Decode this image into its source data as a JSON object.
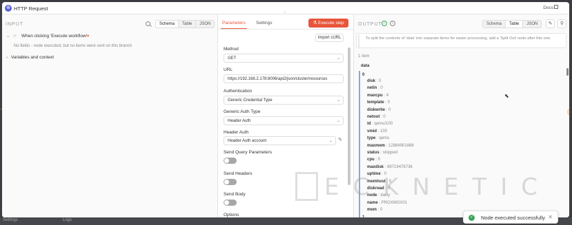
{
  "window": {
    "title": "HTTP Request",
    "docs_label": "Docs"
  },
  "input": {
    "label": "INPUT",
    "views": [
      "Schema",
      "Table",
      "JSON"
    ],
    "active_view": "Schema",
    "trigger_label": "When clicking 'Execute workflow'",
    "no_fields_text": "No fields - node executed, but no items were sent on this branch",
    "vars_label": "Variables and context"
  },
  "params": {
    "tabs": [
      "Parameters",
      "Settings"
    ],
    "execute_label": "Execute step",
    "import_curl_label": "Import cURL",
    "method_label": "Method",
    "method_value": "GET",
    "url_label": "URL",
    "url_value": "https://192.168.2.178:8006/api2/json/cluster/resources",
    "auth_label": "Authentication",
    "auth_value": "Generic Credential Type",
    "generic_auth_label": "Generic Auth Type",
    "generic_auth_value": "Header Auth",
    "header_auth_label": "Header Auth",
    "header_auth_value": "Header Auth account",
    "send_query_label": "Send Query Parameters",
    "send_headers_label": "Send Headers",
    "send_body_label": "Send Body",
    "options_label": "Options"
  },
  "output": {
    "label": "OUTPUT",
    "views": [
      "Schema",
      "Table",
      "JSON"
    ],
    "active_view": "Table",
    "notice": "To split the contents of 'data' into separate items for easier processing, add a 'Split Out' node after this one.",
    "item_count": "1 item",
    "root_key": "data",
    "index_0": "0",
    "index_1": "1",
    "fields": [
      {
        "k": "disk",
        "v": "0"
      },
      {
        "k": "netin",
        "v": "0"
      },
      {
        "k": "maxcpu",
        "v": "4"
      },
      {
        "k": "template",
        "v": "0"
      },
      {
        "k": "diskwrite",
        "v": "0"
      },
      {
        "k": "netout",
        "v": "0"
      },
      {
        "k": "id",
        "v": "qemu/100"
      },
      {
        "k": "vmid",
        "v": "100"
      },
      {
        "k": "type",
        "v": "qemu"
      },
      {
        "k": "maxmem",
        "v": "12884901888"
      },
      {
        "k": "status",
        "v": "stopped"
      },
      {
        "k": "cpu",
        "v": "0"
      },
      {
        "k": "maxdisk",
        "v": "68719476736"
      },
      {
        "k": "uptime",
        "v": "0"
      },
      {
        "k": "memhost",
        "v": "0"
      },
      {
        "k": "diskread",
        "v": "0"
      },
      {
        "k": "node",
        "v": "daisy"
      },
      {
        "k": "name",
        "v": "PROXMOX01"
      },
      {
        "k": "mem",
        "v": "0"
      }
    ]
  },
  "watermark": {
    "text": "ECKNETIC"
  },
  "background": {
    "bottom_left_text": "Settings",
    "bottom_mid_text": "Logs"
  },
  "toast": {
    "message": "Node executed successfully"
  },
  "icons": {
    "window_icon": "globe-icon",
    "execute_icon": "flask-icon",
    "success_icon": "check-circle-icon"
  }
}
